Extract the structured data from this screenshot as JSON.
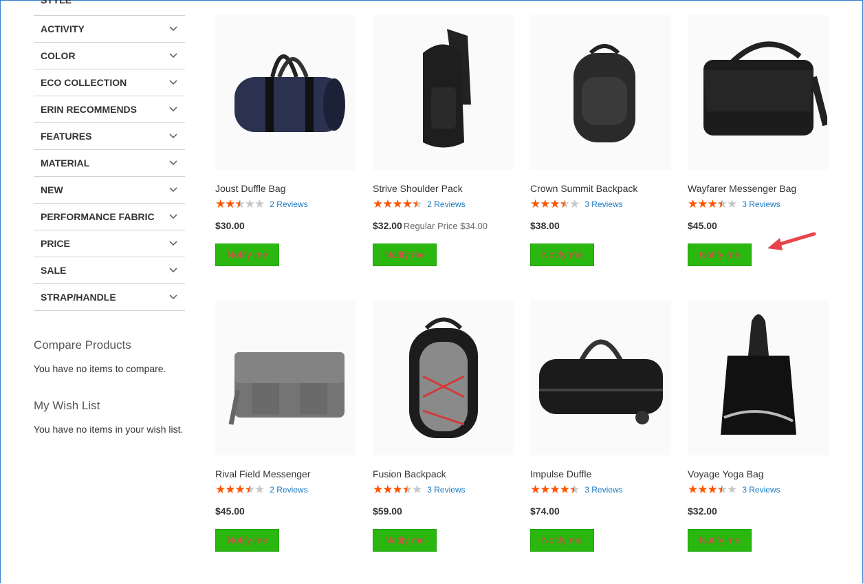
{
  "sidebar": {
    "cut_label": "STYLE",
    "filters": [
      {
        "label": "ACTIVITY"
      },
      {
        "label": "COLOR"
      },
      {
        "label": "ECO COLLECTION"
      },
      {
        "label": "ERIN RECOMMENDS"
      },
      {
        "label": "FEATURES"
      },
      {
        "label": "MATERIAL"
      },
      {
        "label": "NEW"
      },
      {
        "label": "PERFORMANCE FABRIC"
      },
      {
        "label": "PRICE"
      },
      {
        "label": "SALE"
      },
      {
        "label": "STRAP/HANDLE"
      }
    ],
    "compare": {
      "title": "Compare Products",
      "text": "You have no items to compare."
    },
    "wishlist": {
      "title": "My Wish List",
      "text": "You have no items in your wish list."
    }
  },
  "products": [
    {
      "name": "Joust Duffle Bag",
      "rating": 2.5,
      "reviews": "2  Reviews",
      "price": "$30.00",
      "regular": "",
      "button": "Notify me",
      "icon": "duffle-bag-image"
    },
    {
      "name": "Strive Shoulder Pack",
      "rating": 4.5,
      "reviews": "2  Reviews",
      "price": "$32.00",
      "regular": "Regular Price $34.00",
      "button": "Notify me",
      "icon": "shoulder-pack-image"
    },
    {
      "name": "Crown Summit Backpack",
      "rating": 3.5,
      "reviews": "3  Reviews",
      "price": "$38.00",
      "regular": "",
      "button": "Notify me",
      "icon": "backpack-image"
    },
    {
      "name": "Wayfarer Messenger Bag",
      "rating": 3.5,
      "reviews": "3  Reviews",
      "price": "$45.00",
      "regular": "",
      "button": "Notify me",
      "icon": "messenger-bag-image"
    },
    {
      "name": "Rival Field Messenger",
      "rating": 3.5,
      "reviews": "2  Reviews",
      "price": "$45.00",
      "regular": "",
      "button": "Notify me",
      "icon": "field-messenger-image"
    },
    {
      "name": "Fusion Backpack",
      "rating": 3.5,
      "reviews": "3  Reviews",
      "price": "$59.00",
      "regular": "",
      "button": "Notify me",
      "icon": "fusion-backpack-image"
    },
    {
      "name": "Impulse Duffle",
      "rating": 4.5,
      "reviews": "3  Reviews",
      "price": "$74.00",
      "regular": "",
      "button": "Notify me",
      "icon": "rolling-duffle-image"
    },
    {
      "name": "Voyage Yoga Bag",
      "rating": 3.5,
      "reviews": "3  Reviews",
      "price": "$32.00",
      "regular": "",
      "button": "Notify me",
      "icon": "yoga-bag-image"
    }
  ],
  "colors": {
    "accent_link": "#1979c3",
    "star": "#ff5501",
    "notify_bg": "#29b710",
    "notify_text": "#d64949",
    "arrow": "#e8434b"
  }
}
